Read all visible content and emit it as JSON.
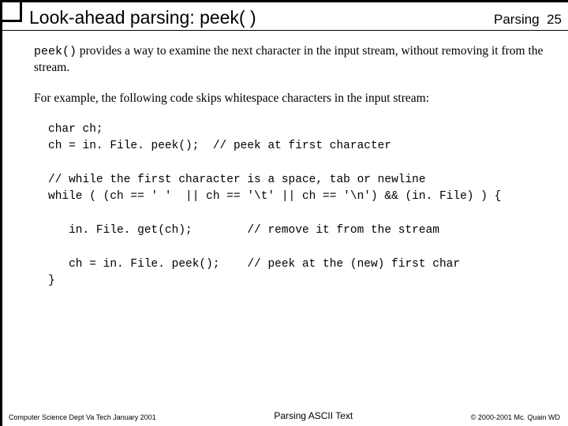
{
  "header": {
    "title": "Look-ahead parsing:  peek( )",
    "section": "Parsing",
    "page_no": "25"
  },
  "intro": {
    "code_token": "peek()",
    "text_after": " provides a way to examine the next character in the input stream, without removing it from the stream."
  },
  "para2": "For example, the following code skips whitespace characters in the input stream:",
  "code": {
    "l1": "char ch;",
    "l2": "ch = in. File. peek();  // peek at first character",
    "l3": "// while the first character is a space, tab or newline",
    "l4": "while ( (ch == ' '  || ch == '\\t' || ch == '\\n') && (in. File) ) {",
    "l5": "   in. File. get(ch);        // remove it from the stream",
    "l6": "   ch = in. File. peek();    // peek at the (new) first char",
    "l7": "}"
  },
  "footer": {
    "left": "Computer Science Dept Va Tech January 2001",
    "center": "Parsing ASCII Text",
    "right": "© 2000-2001  Mc. Quain WD"
  }
}
